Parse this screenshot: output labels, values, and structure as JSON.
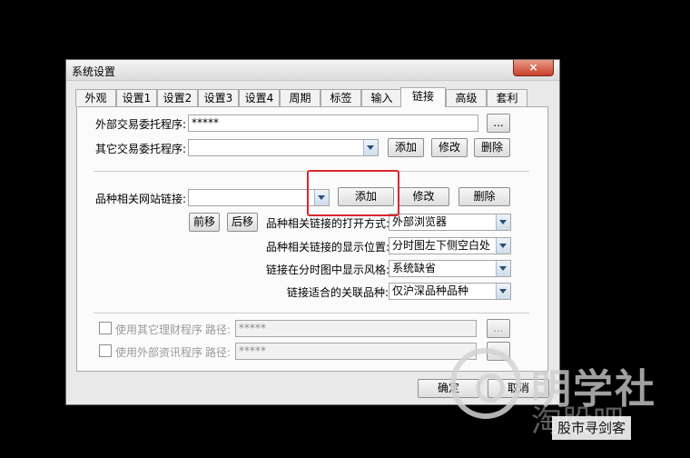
{
  "window": {
    "title": "系统设置",
    "close_label": "×"
  },
  "tabs": [
    {
      "label": "外观"
    },
    {
      "label": "设置1"
    },
    {
      "label": "设置2"
    },
    {
      "label": "设置3"
    },
    {
      "label": "设置4"
    },
    {
      "label": "周期"
    },
    {
      "label": "标签"
    },
    {
      "label": "输入"
    },
    {
      "label": "链接"
    },
    {
      "label": "高级"
    },
    {
      "label": "套利"
    }
  ],
  "trade": {
    "external_label": "外部交易委托程序:",
    "external_value": "*****",
    "browse_label": "...",
    "other_label": "其它交易委托程序:",
    "other_value": "",
    "add_label": "添加",
    "edit_label": "修改",
    "delete_label": "删除"
  },
  "website": {
    "label": "品种相关网站链接:",
    "value": "",
    "add_label": "添加",
    "edit_label": "修改",
    "delete_label": "删除",
    "move_up_label": "前移",
    "move_down_label": "后移"
  },
  "link_options": [
    {
      "label": "品种相关链接的打开方式:",
      "value": "外部浏览器"
    },
    {
      "label": "品种相关链接的显示位置:",
      "value": "分时图左下侧空白处"
    },
    {
      "label": "链接在分时图中显示风格:",
      "value": "系统缺省"
    },
    {
      "label": "链接适合的关联品种:",
      "value": "仅沪深品种品种"
    }
  ],
  "programs": [
    {
      "label": "使用其它理财程序",
      "path_label": "路径:",
      "path_value": "*****",
      "browse_label": "..."
    },
    {
      "label": "使用外部资讯程序",
      "path_label": "路径:",
      "path_value": "*****",
      "browse_label": "..."
    }
  ],
  "footer": {
    "ok_label": "确定",
    "cancel_label": "取消"
  },
  "watermark": {
    "brand": "明学社",
    "sub": "淘股吧",
    "source": "股市寻剑客"
  }
}
